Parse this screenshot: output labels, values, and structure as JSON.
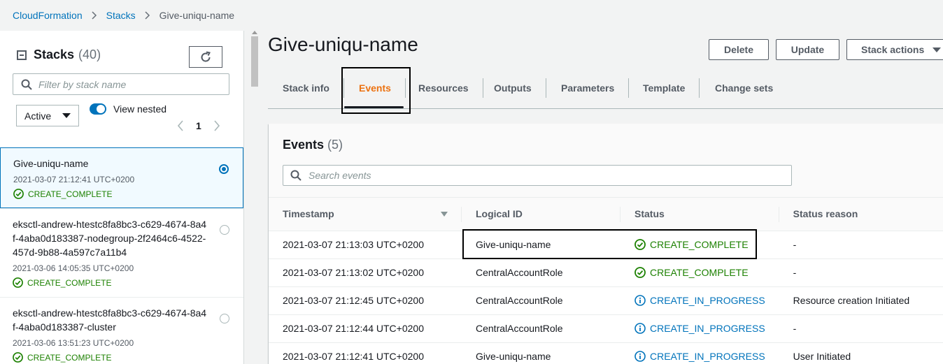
{
  "breadcrumb": {
    "items": [
      "CloudFormation",
      "Stacks"
    ],
    "current": "Give-uniqu-name"
  },
  "sidebar": {
    "title": "Stacks",
    "count": "(40)",
    "filter_placeholder": "Filter by stack name",
    "status_filter": "Active",
    "view_nested_label": "View nested",
    "view_nested_on": true,
    "page": "1",
    "stacks": [
      {
        "name": "Give-uniqu-name",
        "time": "2021-03-07 21:12:41 UTC+0200",
        "status": "CREATE_COMPLETE",
        "selected": true
      },
      {
        "name": "eksctl-andrew-htestc8fa8bc3-c629-4674-8a4f-4aba0d183387-nodegroup-2f2464c6-4522-457d-9b88-4a597c7a11b4",
        "time": "2021-03-06 14:05:35 UTC+0200",
        "status": "CREATE_COMPLETE",
        "selected": false
      },
      {
        "name": "eksctl-andrew-htestc8fa8bc3-c629-4674-8a4f-4aba0d183387-cluster",
        "time": "2021-03-06 13:51:23 UTC+0200",
        "status": "CREATE_COMPLETE",
        "selected": false
      }
    ]
  },
  "main": {
    "title": "Give-uniqu-name",
    "buttons": {
      "delete": "Delete",
      "update": "Update",
      "stack_actions": "Stack actions"
    },
    "tabs": [
      "Stack info",
      "Events",
      "Resources",
      "Outputs",
      "Parameters",
      "Template",
      "Change sets"
    ],
    "active_tab": "Events"
  },
  "events": {
    "title": "Events",
    "count": "(5)",
    "search_placeholder": "Search events",
    "columns": [
      "Timestamp",
      "Logical ID",
      "Status",
      "Status reason"
    ],
    "rows": [
      {
        "timestamp": "2021-03-07 21:13:03 UTC+0200",
        "logical_id": "Give-uniqu-name",
        "status": "CREATE_COMPLETE",
        "status_type": "complete",
        "reason": "-"
      },
      {
        "timestamp": "2021-03-07 21:13:02 UTC+0200",
        "logical_id": "CentralAccountRole",
        "status": "CREATE_COMPLETE",
        "status_type": "complete",
        "reason": "-"
      },
      {
        "timestamp": "2021-03-07 21:12:45 UTC+0200",
        "logical_id": "CentralAccountRole",
        "status": "CREATE_IN_PROGRESS",
        "status_type": "progress",
        "reason": "Resource creation Initiated"
      },
      {
        "timestamp": "2021-03-07 21:12:44 UTC+0200",
        "logical_id": "CentralAccountRole",
        "status": "CREATE_IN_PROGRESS",
        "status_type": "progress",
        "reason": "-"
      },
      {
        "timestamp": "2021-03-07 21:12:41 UTC+0200",
        "logical_id": "Give-uniqu-name",
        "status": "CREATE_IN_PROGRESS",
        "status_type": "progress",
        "reason": "User Initiated"
      }
    ]
  },
  "colors": {
    "link": "#0073bb",
    "success": "#1d8102",
    "info": "#0073bb",
    "active_tab": "#ec7211"
  },
  "icons": {
    "success": "check-circle-icon",
    "info": "info-circle-icon",
    "refresh": "refresh-icon",
    "search": "search-icon"
  }
}
